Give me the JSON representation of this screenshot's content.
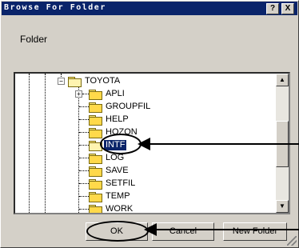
{
  "window": {
    "title": "Browse For Folder"
  },
  "titlebar_buttons": {
    "help": "?",
    "close": "X"
  },
  "folder_label": "Folder",
  "tree": {
    "root": "TOYOTA",
    "items": [
      {
        "label": "APLI",
        "expandable": true
      },
      {
        "label": "GROUPFIL"
      },
      {
        "label": "HELP"
      },
      {
        "label": "HOZON"
      },
      {
        "label": "INTF",
        "selected": true
      },
      {
        "label": "LOG"
      },
      {
        "label": "SAVE"
      },
      {
        "label": "SETFIL"
      },
      {
        "label": "TEMP"
      },
      {
        "label": "WORK"
      }
    ],
    "root_toggle": "−",
    "expand_toggle": "+"
  },
  "scrollbar": {
    "up_glyph": "▲",
    "down_glyph": "▼"
  },
  "buttons": {
    "ok": "OK",
    "cancel": "Cancel",
    "new_folder": "New Folder"
  }
}
